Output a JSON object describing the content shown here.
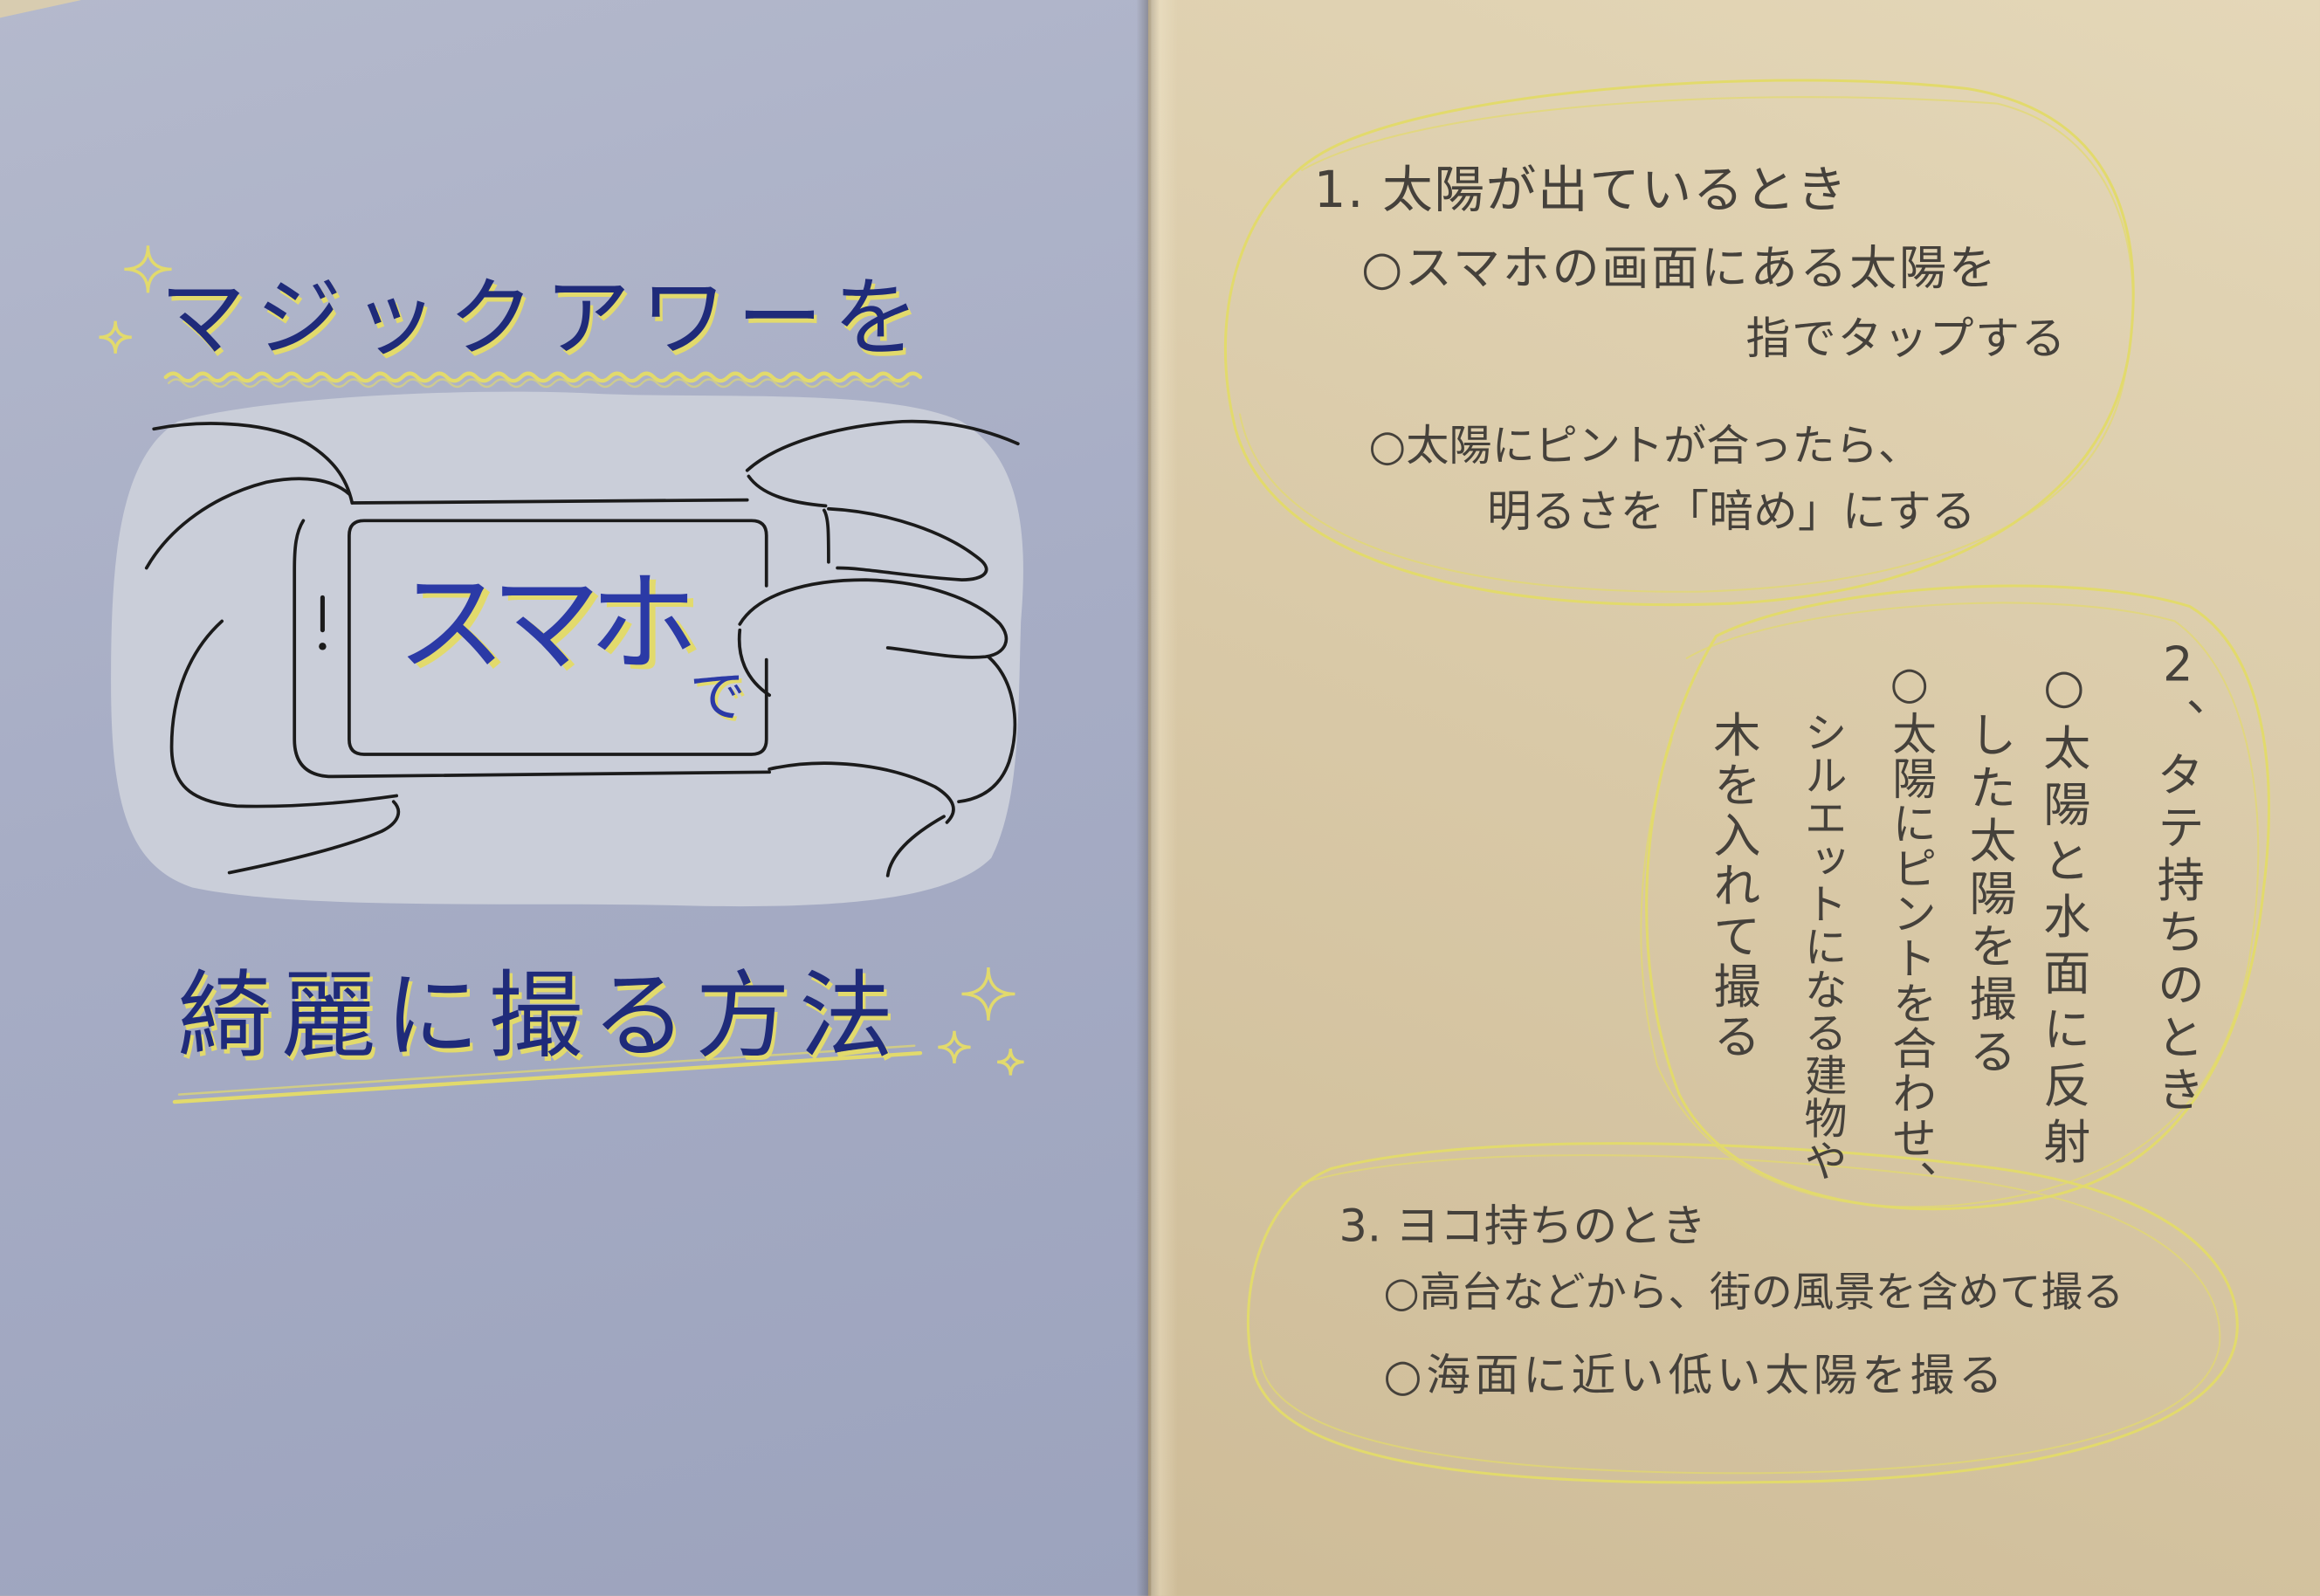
{
  "left_page": {
    "title_top": "マジックアワーを",
    "phone_screen": {
      "main": "スマホ",
      "small": "で"
    },
    "title_bottom": "綺麗に撮る方法"
  },
  "right_page": {
    "section_1": {
      "heading": "1. 太陽が出ているとき",
      "lines": [
        "○スマホの画面にある太陽を",
        "指でタップする",
        "○太陽にピントが合ったら、",
        "明るさを「暗め」にする"
      ]
    },
    "section_2": {
      "number": "2、",
      "heading": "タテ持ちのとき",
      "lines": [
        "○太陽と水面に反射",
        "した太陽を撮る",
        "○太陽にピントを合わせ、",
        "シルエットになる建物や",
        "木を入れて撮る"
      ]
    },
    "section_3": {
      "heading": "3. ヨコ持ちのとき",
      "lines": [
        "○高台などから、街の風景を含めて撮る",
        "○海面に近い低い太陽を撮る"
      ]
    }
  },
  "icons": {
    "decoration": "sparkle-icon"
  },
  "colors": {
    "left_paper": "#a7adc5",
    "right_paper": "#d9c9a7",
    "title_ink": "#1f2b7a",
    "screen_ink": "#2b3aa6",
    "highlight_yellow": "#e2da6c",
    "pencil": "#45413b",
    "line_art": "#1b1b1b"
  }
}
